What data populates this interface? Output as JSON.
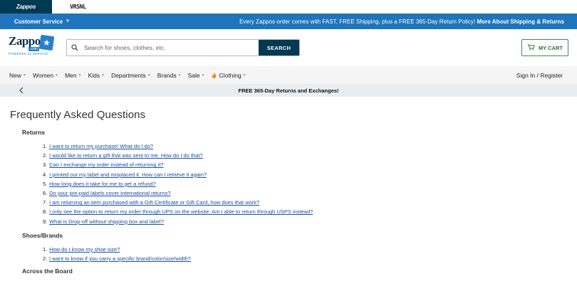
{
  "brand_tabs": [
    {
      "label": "Zappos",
      "active": true
    },
    {
      "label": "vrsnl",
      "active": false
    }
  ],
  "promo_bar": {
    "customer_service_label": "Customer Service",
    "message": "Every Zappos order comes with FAST, FREE Shipping, plus a FREE 365-Day Return Policy!",
    "link_label": "More About Shipping & Returns"
  },
  "header": {
    "logo": {
      "word": "Zappos",
      "sub": ".com",
      "tagline": "POWERED by SERVICE"
    },
    "search": {
      "placeholder": "Search for shoes, clothes, etc.",
      "value": "",
      "button_label": "SEARCH"
    },
    "cart_label": "MY CART"
  },
  "nav": {
    "items": [
      {
        "label": "New"
      },
      {
        "label": "Women"
      },
      {
        "label": "Men"
      },
      {
        "label": "Kids"
      },
      {
        "label": "Departments"
      },
      {
        "label": "Brands"
      },
      {
        "label": "Sale"
      },
      {
        "label": "Clothing"
      }
    ],
    "signin_label": "Sign In / Register"
  },
  "returns_banner": {
    "text": "FREE 365-Day Returns and Exchanges!"
  },
  "faq": {
    "title": "Frequently Asked Questions",
    "sections": [
      {
        "title": "Returns",
        "questions": [
          "I want to return my purchase! What do I do?",
          "I would like to return a gift that was sent to me. How do I do that?",
          "Can I exchange my order instead of returning it?",
          "I printed out my label and misplaced it. How can I retrieve it again?",
          "How long does it take for me to get a refund?",
          "Do your pre-paid labels cover international returns?",
          "I am returning an item purchased with a Gift Certificate or Gift Card, how does that work?",
          "I only see the option to return my order through UPS on the website. Am I able to return through USPS instead?",
          "What is Drop-off without shipping box and label?"
        ]
      },
      {
        "title": "Shoes/Brands",
        "questions": [
          "How do I know my shoe size?",
          "I want to know if you carry a specific brand/color/size/width?"
        ]
      },
      {
        "title": "Across the Board",
        "questions": []
      }
    ]
  },
  "colors": {
    "promo_blue": "#1f75bb",
    "navy": "#003953",
    "cart_green": "#3b8b4c",
    "link_blue": "#1a4fa0"
  }
}
